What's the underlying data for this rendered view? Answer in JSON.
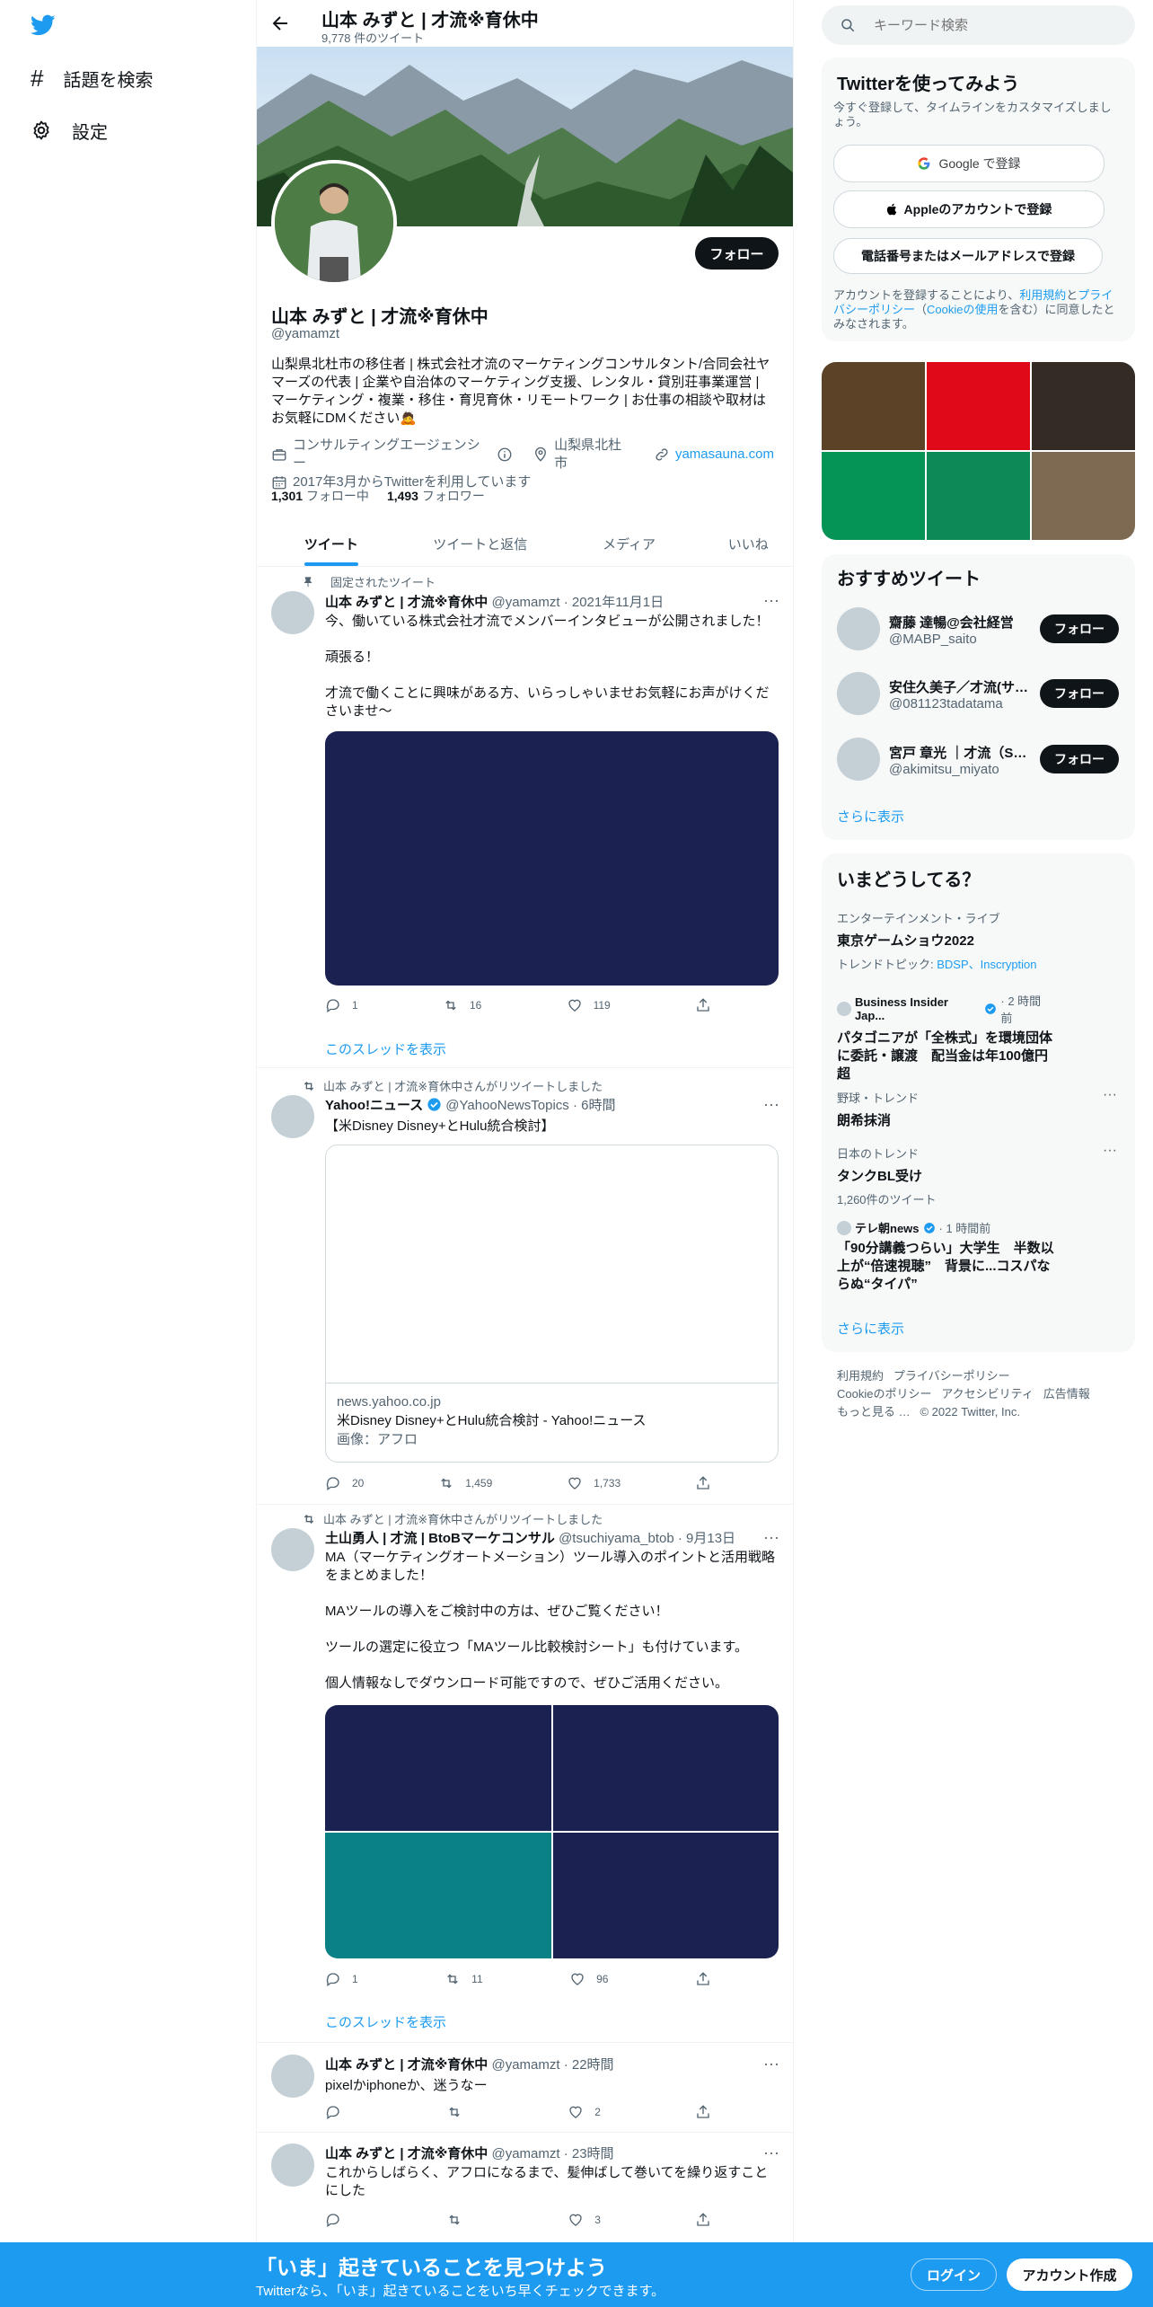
{
  "left_nav": {
    "explore": "話題を検索",
    "settings": "設定"
  },
  "header": {
    "name": "山本 みずと | 才流※育休中",
    "tweet_count": "9,778 件のツイート"
  },
  "profile": {
    "follow_button": "フォロー",
    "name": "山本 みずと | 才流※育休中",
    "handle": "@yamamzt",
    "bio": "山梨県北杜市の移住者 | 株式会社才流のマーケティングコンサルタント/合同会社ヤマーズの代表 | 企業や自治体のマーケティング支援、レンタル・貸別荘事業運営 | マーケティング・複業・移住・育児育休・リモートワーク | お仕事の相談や取材はお気軽にDMください🙇",
    "category": "コンサルティングエージェンシー",
    "location": "山梨県北杜市",
    "website": "yamasauna.com",
    "joined": "2017年3月からTwitterを利用しています",
    "following_count": "1,301",
    "following_label": "フォロー中",
    "followers_count": "1,493",
    "followers_label": "フォロワー"
  },
  "tabs": [
    "ツイート",
    "ツイートと返信",
    "メディア",
    "いいね"
  ],
  "tweets": [
    {
      "context": "固定されたツイート",
      "name": "山本 みずと | 才流※育休中",
      "meta": "@yamamzt · 2021年11月1日",
      "text": "今、働いている株式会社才流でメンバーインタビューが公開されました！\n\n頑張る！\n\n才流で働くことに興味がある方、いらっしゃいませお気軽にお声がけくださいませ〜",
      "reply": "1",
      "retweet": "16",
      "like": "119",
      "show_thread": "このスレッドを表示"
    },
    {
      "context": "山本 みずと | 才流※育休中さんがリツイートしました",
      "name": "Yahoo!ニュース",
      "meta": "@YahooNewsTopics · 6時間",
      "text": "【米Disney Disney+とHulu統合検討】",
      "card_domain": "news.yahoo.co.jp",
      "card_title": "米Disney Disney+とHulu統合検討 - Yahoo!ニュース",
      "card_desc": "画像：アフロ",
      "reply": "20",
      "retweet": "1,459",
      "like": "1,733"
    },
    {
      "context": "山本 みずと | 才流※育休中さんがリツイートしました",
      "name": "土山勇人 | 才流 | BtoBマーケコンサル",
      "meta": "@tsuchiyama_btob · 9月13日",
      "text": "MA（マーケティングオートメーション）ツール導入のポイントと活用戦略をまとめました！\n\nMAツールの導入をご検討中の方は、ぜひご覧ください！\n\nツールの選定に役立つ「MAツール比較検討シート」も付けています。\n\n個人情報なしでダウンロード可能ですので、ぜひご活用ください。",
      "reply": "1",
      "retweet": "11",
      "like": "96",
      "show_thread": "このスレッドを表示"
    },
    {
      "name": "山本 みずと | 才流※育休中",
      "meta": "@yamamzt · 22時間",
      "text": "pixelかiphoneか、迷うなー",
      "reply": "",
      "retweet": "",
      "like": "2"
    },
    {
      "name": "山本 みずと | 才流※育休中",
      "meta": "@yamamzt · 23時間",
      "text": "これからしばらく、アフロになるまで、髪伸ばして巻いてを繰り返すことにした",
      "reply": "",
      "retweet": "",
      "like": "3"
    }
  ],
  "search": {
    "placeholder": "キーワード検索"
  },
  "signup": {
    "title": "Twitterを使ってみよう",
    "subtitle": "今すぐ登録して、タイムラインをカスタマイズしましょう。",
    "google": "Google で登録",
    "apple": "Appleのアカウントで登録",
    "phone": "電話番号またはメールアドレスで登録",
    "legal_1": "アカウントを登録することにより、",
    "legal_terms": "利用規約",
    "legal_2": "と",
    "legal_privacy": "プライバシーポリシー",
    "legal_3": "（",
    "legal_cookie": "Cookieの使用",
    "legal_4": "を含む）に同意したとみなされます。"
  },
  "media_grid_colors": [
    "#5c4328",
    "#e0091a",
    "#352b25",
    "#069356",
    "#0b8a55",
    "#7e6a52"
  ],
  "recommended": {
    "title": "おすすめツイート",
    "users": [
      {
        "name": "齋藤 達暢@会社経営",
        "handle": "@MABP_saito",
        "button": "フォロー"
      },
      {
        "name": "安住久美子／才流(サ…",
        "handle": "@081123tadatama",
        "button": "フォロー"
      },
      {
        "name": "宮戸 章光 ｜才流（S…",
        "handle": "@akimitsu_miyato",
        "button": "フォロー"
      }
    ],
    "more": "さらに表示"
  },
  "trends": {
    "title": "いまどうしてる？",
    "items": [
      {
        "context": "エンターテインメント・ライブ",
        "title": "東京ゲームショウ2022",
        "topic_label": "トレンドトピック:",
        "topics": "BDSP、Inscryption"
      },
      {
        "source": "Business Insider Jap...",
        "time": "· 2 時間前",
        "title": "パタゴニアが「全株式」を環境団体に委託・譲渡　配当金は年100億円超"
      },
      {
        "context": "野球・トレンド",
        "title": "朗希抹消"
      },
      {
        "context": "日本のトレンド",
        "title": "タンクBL受け",
        "count": "1,260件のツイート"
      },
      {
        "source": "テレ朝news",
        "time": "· 1 時間前",
        "title": "「90分講義つらい」大学生　半数以上が“倍速視聴”　背景に...コスパならぬ“タイパ”"
      }
    ],
    "more": "さらに表示"
  },
  "footer": {
    "terms": "利用規約",
    "privacy": "プライバシーポリシー",
    "cookie": "Cookieのポリシー",
    "accessibility": "アクセシビリティ",
    "ads": "広告情報",
    "more": "もっと見る …",
    "copyright": "© 2022 Twitter, Inc."
  },
  "bottom_bar": {
    "title": "「いま」起きていることを見つけよう",
    "subtitle": "Twitterなら、「いま」起きていることをいち早くチェックできます。",
    "login": "ログイン",
    "signup": "アカウント作成"
  },
  "colors": {
    "accent": "#1d9bf0",
    "media_navy": "#1b2150",
    "media_teal": "#0a8285"
  }
}
